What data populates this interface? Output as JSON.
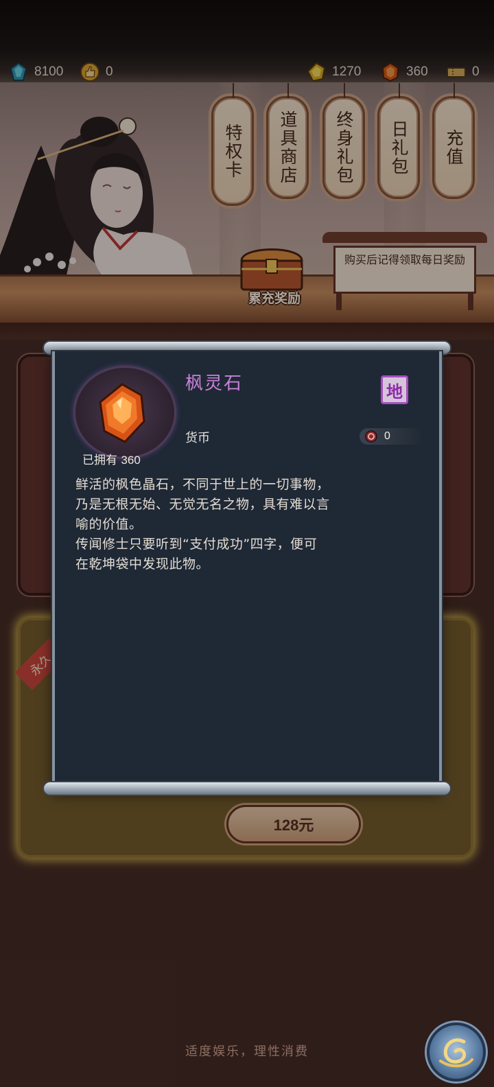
{
  "currencies": {
    "jade": {
      "value": "8100",
      "icon": "blue-jade-icon",
      "color": "#3ec2d6"
    },
    "likes": {
      "value": "0",
      "icon": "thumbs-up-icon",
      "color": "#e2b53c"
    },
    "spirit_stone": {
      "value": "1270",
      "icon": "gold-spirit-stone-icon",
      "color": "#e8c63a"
    },
    "maple_stone": {
      "value": "360",
      "icon": "maple-spirit-stone-icon",
      "color": "#e56a24"
    },
    "ticket": {
      "value": "0",
      "icon": "ticket-icon",
      "color": "#d7b361"
    }
  },
  "shop_tabs": [
    {
      "label": "特权卡"
    },
    {
      "label": "道具商店"
    },
    {
      "label": "终身礼包"
    },
    {
      "label": "日礼包"
    },
    {
      "label": "充值"
    }
  ],
  "notice_board": {
    "text": "购买后记得领取每日奖励"
  },
  "chest": {
    "label": "累充奖励"
  },
  "card": {
    "price": "128元",
    "ribbon": "永久"
  },
  "item": {
    "name": "枫灵石",
    "grade": "地",
    "type": "货币",
    "price": "0",
    "owned_label": "已拥有",
    "owned_count": "360",
    "description": [
      "鲜活的枫色晶石，不同于世上的一切事物，",
      "乃是无根无始、无觉无名之物，具有难以言",
      "喻的价值。",
      "传闻修士只要听到“支付成功”四字，便可",
      "在乾坤袋中发现此物。"
    ],
    "name_color": "#c981d8",
    "grade_color": "#a64dbf"
  },
  "footer": {
    "note": "适度娱乐，理性消费"
  }
}
